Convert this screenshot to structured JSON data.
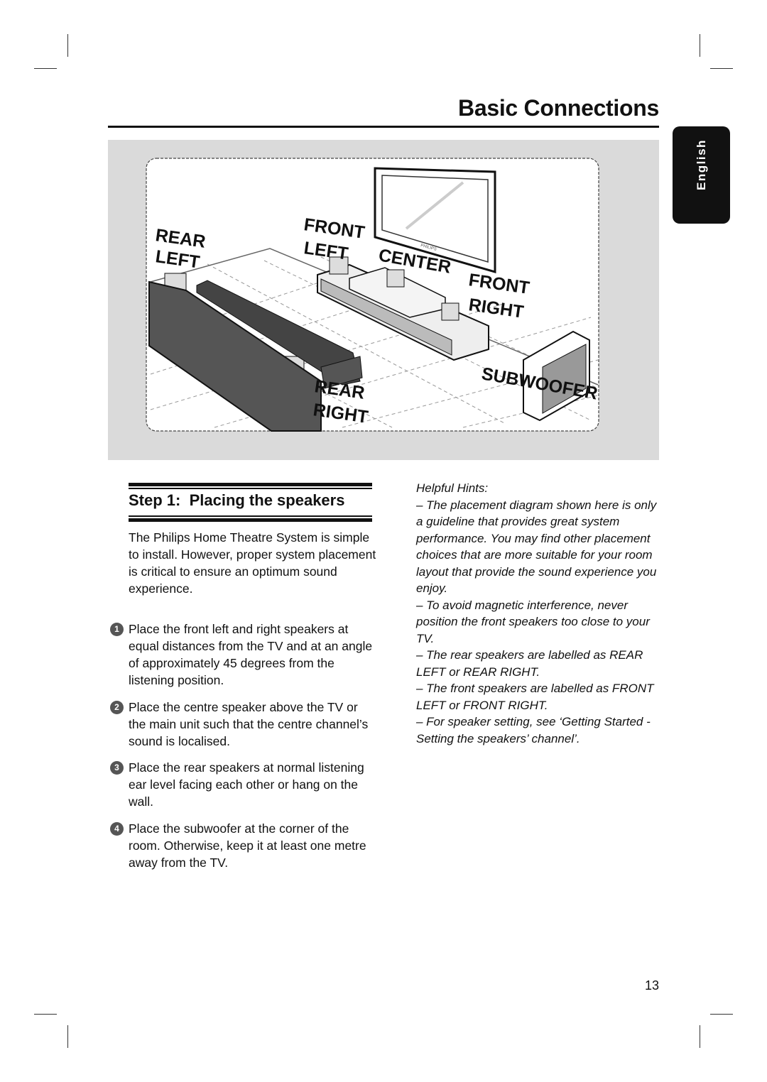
{
  "header": {
    "title": "Basic Connections",
    "language_tab": "English"
  },
  "figure": {
    "labels": {
      "rear_left": [
        "REAR",
        "LEFT"
      ],
      "front_left": [
        "FRONT",
        "LEFT"
      ],
      "center": "CENTER",
      "front_right": [
        "FRONT",
        "RIGHT"
      ],
      "rear_right": [
        "REAR",
        "RIGHT"
      ],
      "subwoofer": "SUBWOOFER",
      "tv_brand": "PHILIPS"
    }
  },
  "section": {
    "title": "Step 1:  Placing the speakers",
    "intro": "The Philips Home Theatre System is simple to install. However, proper system placement is critical to ensure an optimum sound experience.",
    "steps": [
      {
        "num": "1",
        "text": "Place the front left and right speakers at equal distances from the TV and at an angle of approximately 45 degrees from the listening position."
      },
      {
        "num": "2",
        "text": "Place the centre speaker above the TV or the main unit such that the centre channel’s sound is localised."
      },
      {
        "num": "3",
        "text": "Place the rear speakers at normal listening ear level facing each other or hang on the wall."
      },
      {
        "num": "4",
        "text": "Place the subwoofer at the corner of the room. Otherwise, keep it at least one metre away from the TV."
      }
    ]
  },
  "hints": {
    "title": "Helpful Hints:",
    "items": [
      "– The placement diagram shown here is only a guideline that provides great system performance. You may find other placement choices that are more suitable for your room layout that provide the sound experience you enjoy.",
      "– To avoid magnetic interference, never position the front speakers too close to your TV.",
      "– The rear speakers are labelled as REAR LEFT or REAR RIGHT.",
      "– The front speakers are labelled as FRONT LEFT or FRONT RIGHT.",
      "–  For speaker setting, see ‘Getting Started - Setting the speakers’ channel’."
    ]
  },
  "footer": {
    "page_number": "13"
  }
}
